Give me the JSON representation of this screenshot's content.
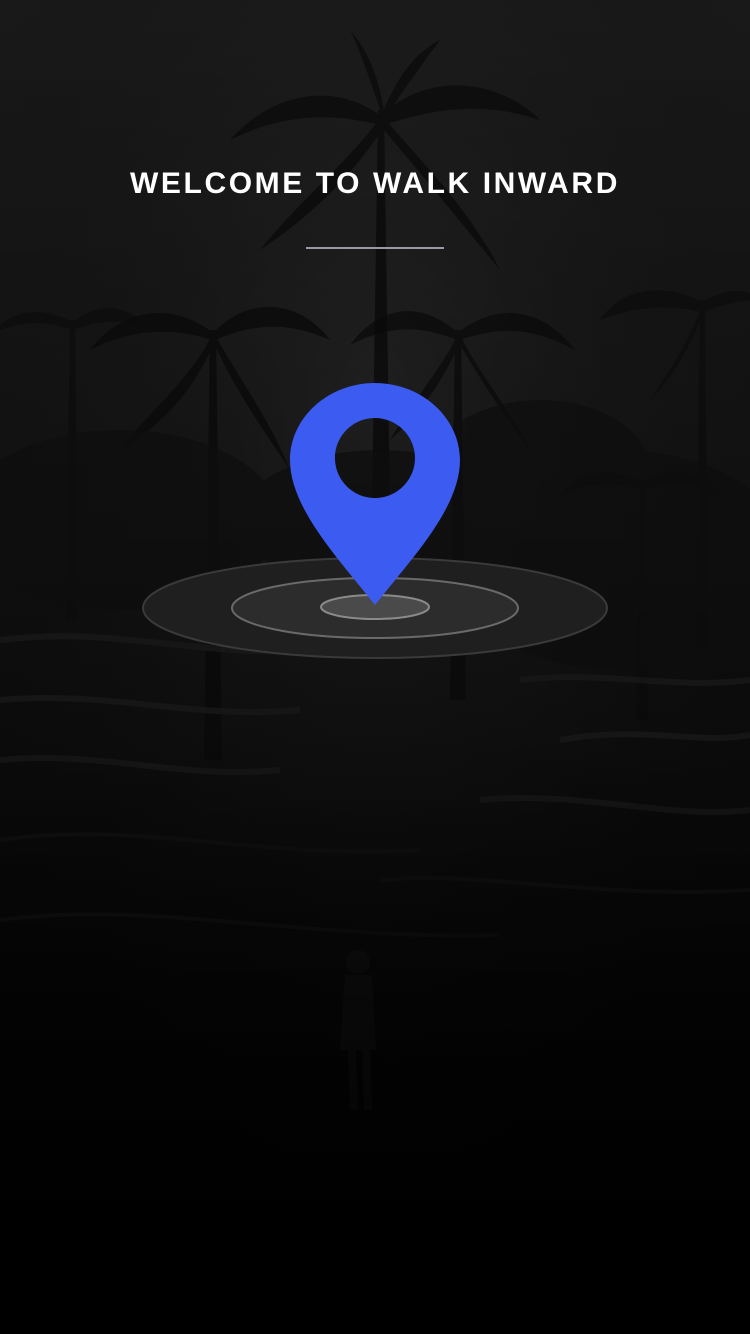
{
  "screen": {
    "title": "WELCOME TO WALK INWARD",
    "background_image": "jungle-rice-terraces-photo",
    "accent_color": "#3c5bf0"
  },
  "icons": {
    "pin": "map-pin-icon",
    "target": "target-rings-icon"
  }
}
